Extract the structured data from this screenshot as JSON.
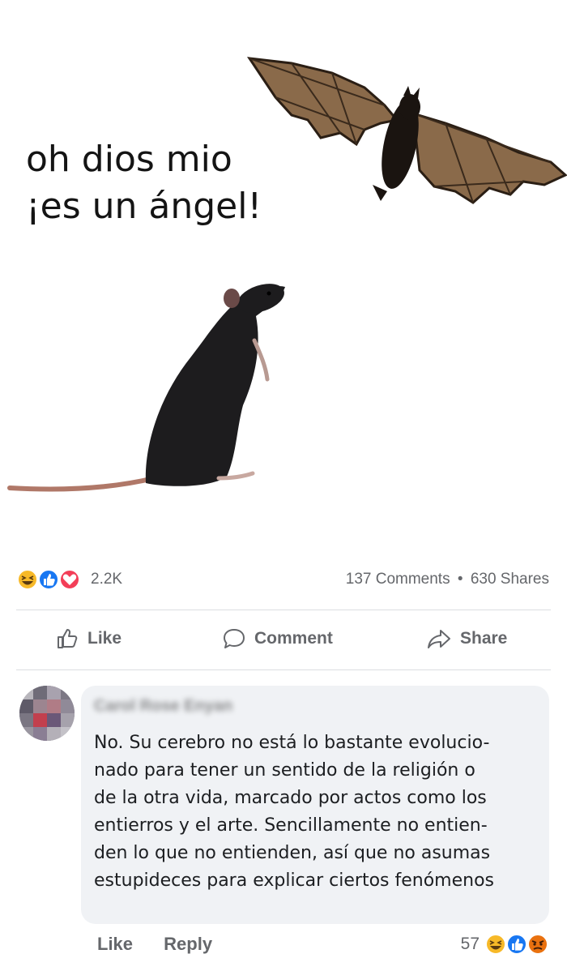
{
  "meme": {
    "caption_line1": "oh dios mio",
    "caption_line2": "¡es un ángel!"
  },
  "post_stats": {
    "reaction_icons": [
      "haha-icon",
      "like-icon",
      "love-icon"
    ],
    "reaction_count": "2.2K",
    "comments": "137 Comments",
    "separator": "•",
    "shares": "630 Shares"
  },
  "actions": {
    "like": "Like",
    "comment": "Comment",
    "share": "Share"
  },
  "comment": {
    "author": "Carol Rose Enyan",
    "lines": [
      "No. Su cerebro no está lo bastante evolucio-",
      "nado para tener un sentido de la religión o",
      "de la otra vida, marcado por actos como los",
      "entierros y el arte. Sencillamente no entien-",
      "den lo que no entienden, así que no asumas",
      "estupideces para explicar ciertos fenómenos"
    ],
    "like_label": "Like",
    "reply_label": "Reply",
    "reaction_count": "57",
    "reaction_icons": [
      "haha-icon",
      "like-icon",
      "angry-icon"
    ]
  },
  "colors": {
    "muted_text": "#65676b",
    "bubble_bg": "#f0f2f5",
    "like_blue": "#1877f2",
    "love_red": "#f33e58",
    "haha_yellow": "#f7b928",
    "angry_orange": "#e9710f"
  }
}
